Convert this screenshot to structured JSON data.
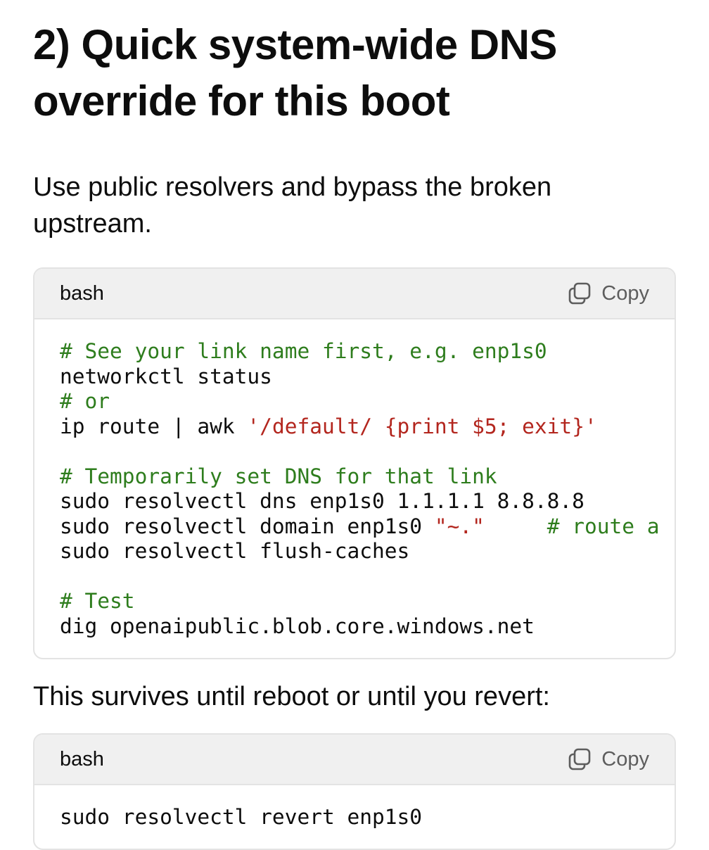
{
  "heading": "2) Quick system-wide DNS override for this boot",
  "intro_text": "Use public resolvers and bypass the broken upstream.",
  "code_block_1": {
    "language": "bash",
    "copy_label": "Copy",
    "lines": {
      "l1": "# See your link name first, e.g. enp1s0",
      "l2": "networkctl status",
      "l3": "# or",
      "l4_code": "ip route | awk ",
      "l4_string": "'/default/ {print $5; exit}'",
      "l6": "# Temporarily set DNS for that link",
      "l7": "sudo resolvectl dns enp1s0 1.1.1.1 8.8.8.8",
      "l8_code": "sudo resolvectl domain enp1s0 ",
      "l8_string": "\"~.\"",
      "l8_pad": "     ",
      "l8_comment": "# route a",
      "l9": "sudo resolvectl flush-caches",
      "l11": "# Test",
      "l12": "dig openaipublic.blob.core.windows.net"
    }
  },
  "middle_text": "This survives until reboot or until you revert:",
  "code_block_2": {
    "language": "bash",
    "copy_label": "Copy",
    "lines": {
      "l1": "sudo resolvectl revert enp1s0"
    }
  },
  "icons": {
    "copy": "copy-icon"
  },
  "colors": {
    "comment": "#2e7d1d",
    "string": "#b3261e",
    "header_bg": "#f0f0f0"
  }
}
